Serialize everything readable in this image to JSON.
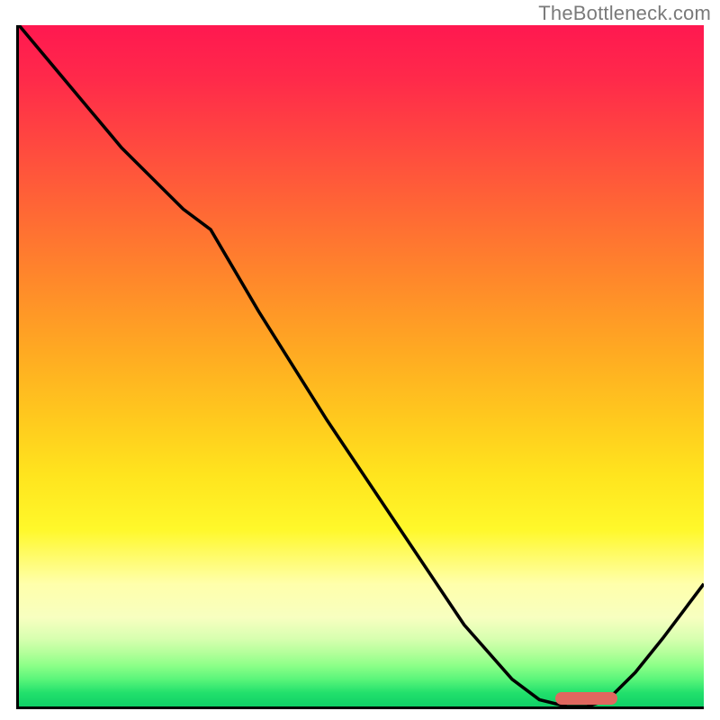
{
  "attribution": "TheBottleneck.com",
  "chart_data": {
    "type": "line",
    "title": "",
    "xlabel": "",
    "ylabel": "",
    "x": [
      0.0,
      0.05,
      0.1,
      0.15,
      0.2,
      0.24,
      0.28,
      0.35,
      0.45,
      0.55,
      0.65,
      0.72,
      0.76,
      0.8,
      0.83,
      0.86,
      0.9,
      0.94,
      0.97,
      1.0
    ],
    "values": [
      1.0,
      0.94,
      0.88,
      0.82,
      0.77,
      0.73,
      0.7,
      0.58,
      0.42,
      0.27,
      0.12,
      0.04,
      0.01,
      0.0,
      0.0,
      0.01,
      0.05,
      0.1,
      0.14,
      0.18
    ],
    "xlim": [
      0,
      1
    ],
    "ylim": [
      0,
      1
    ],
    "background": "rainbow-gradient",
    "marker_region_x": [
      0.78,
      0.87
    ]
  },
  "colors": {
    "curve": "#000000",
    "marker": "#e0675f",
    "axis": "#000000"
  }
}
